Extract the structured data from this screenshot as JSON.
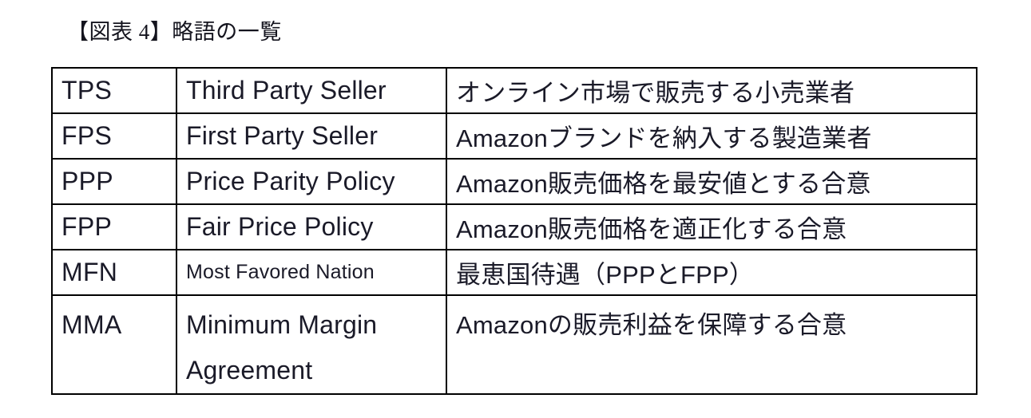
{
  "figure": {
    "caption": "【図表 4】略語の一覧"
  },
  "table": {
    "columns": [
      "abbreviation",
      "full_name",
      "description"
    ],
    "rows": [
      {
        "abbreviation": "TPS",
        "full_name": "Third Party Seller",
        "description": "オンライン市場で販売する小売業者"
      },
      {
        "abbreviation": "FPS",
        "full_name": "First Party Seller",
        "description": "Amazonブランドを納入する製造業者"
      },
      {
        "abbreviation": "PPP",
        "full_name": "Price Parity Policy",
        "description": "Amazon販売価格を最安値とする合意"
      },
      {
        "abbreviation": "FPP",
        "full_name": "Fair Price Policy",
        "description": "Amazon販売価格を適正化する合意"
      },
      {
        "abbreviation": "MFN",
        "full_name": "Most Favored Nation",
        "description": "最恵国待遇（PPPとFPP）"
      },
      {
        "abbreviation": "MMA",
        "full_name_line1": "Minimum Margin",
        "full_name_line2": "Agreement",
        "description": "Amazonの販売利益を保障する合意"
      }
    ]
  },
  "colors": {
    "text": "#1a1a28",
    "border": "#000000",
    "background": "#ffffff"
  }
}
